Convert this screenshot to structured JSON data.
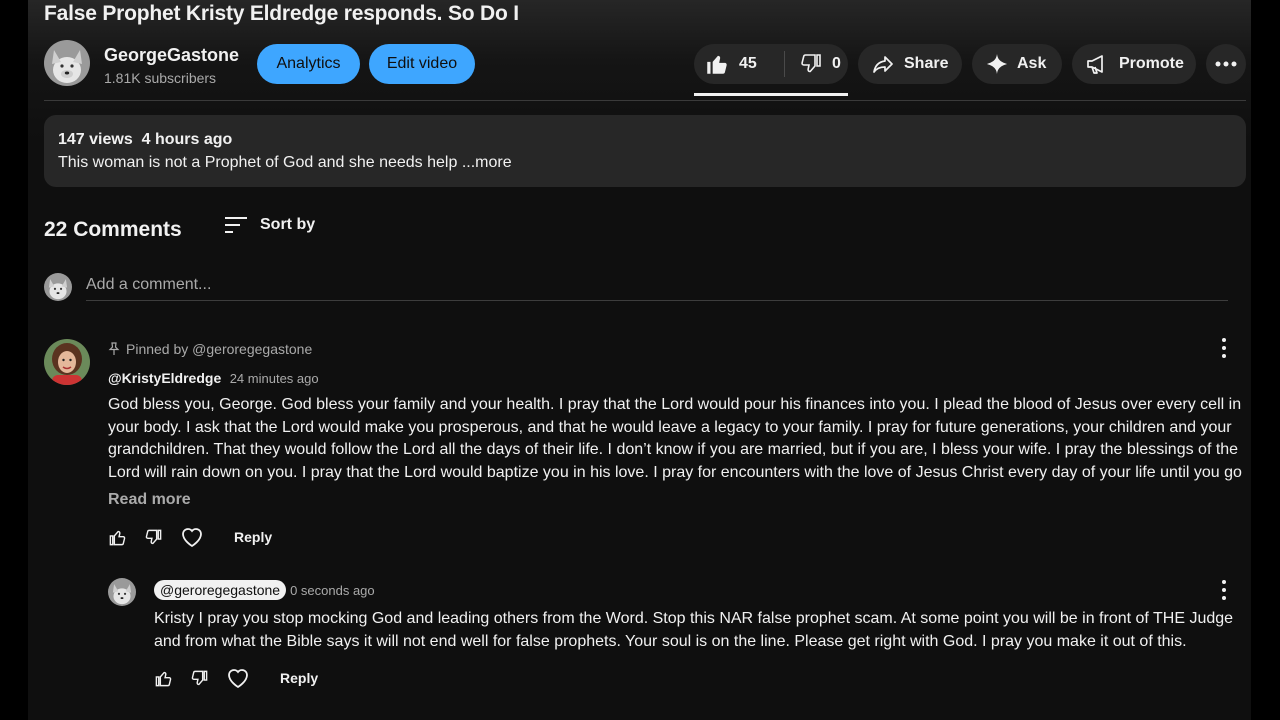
{
  "video": {
    "title": "False Prophet Kristy Eldredge responds. So Do I"
  },
  "channel": {
    "name": "GeorgeGastone",
    "subscribers": "1.81K subscribers",
    "avatar_icon": "wolf-avatar-icon"
  },
  "owner_buttons": {
    "analytics": "Analytics",
    "edit_video": "Edit video"
  },
  "actions": {
    "like_count": "45",
    "dislike_count": "0",
    "share": "Share",
    "ask": "Ask",
    "promote": "Promote"
  },
  "description": {
    "views": "147 views",
    "time": "4 hours ago",
    "text": "This woman is not a Prophet of God and she needs help ",
    "more": "...more"
  },
  "comments_header": {
    "count": "22 Comments",
    "sort": "Sort by"
  },
  "add_comment": {
    "placeholder": "Add a comment..."
  },
  "comments": [
    {
      "pinned": "Pinned by @geroregegastone",
      "author": "@KristyEldredge",
      "time": "24 minutes ago",
      "lines": [
        "God bless you, George. God bless your family and your health. I pray that the Lord would pour his finances into you. I plead the blood of Jesus over every cell in",
        "your body.  I ask that the Lord would make you prosperous, and that he would leave a legacy to your family. I pray for future generations, your children and your",
        "grandchildren. That they would follow the Lord all the days of their life. I don’t know if you are married, but if you are, I bless your wife. I pray the blessings of the",
        "Lord will rain down on you. I pray that the Lord would baptize you in his love. I pray for encounters with the love of Jesus Christ every day of your life until you go …"
      ],
      "read_more": "Read more",
      "reply": "Reply"
    }
  ],
  "reply_comment": {
    "author": "@geroregegastone",
    "time": "0 seconds ago",
    "lines": [
      "Kristy I pray you stop mocking God and leading others from the Word.  Stop this NAR false prophet scam.  At some point you will be in front of THE Judge",
      "and from what the Bible says it will not end well for false prophets.  Your soul is on the line.  Please get right with God.   I pray you make it out of this."
    ],
    "reply": "Reply"
  },
  "colors": {
    "accent_blue": "#3ea6ff",
    "pill_bg": "#272727",
    "page_bg": "#0f0f0f",
    "secondary_text": "#aaaaaa"
  }
}
